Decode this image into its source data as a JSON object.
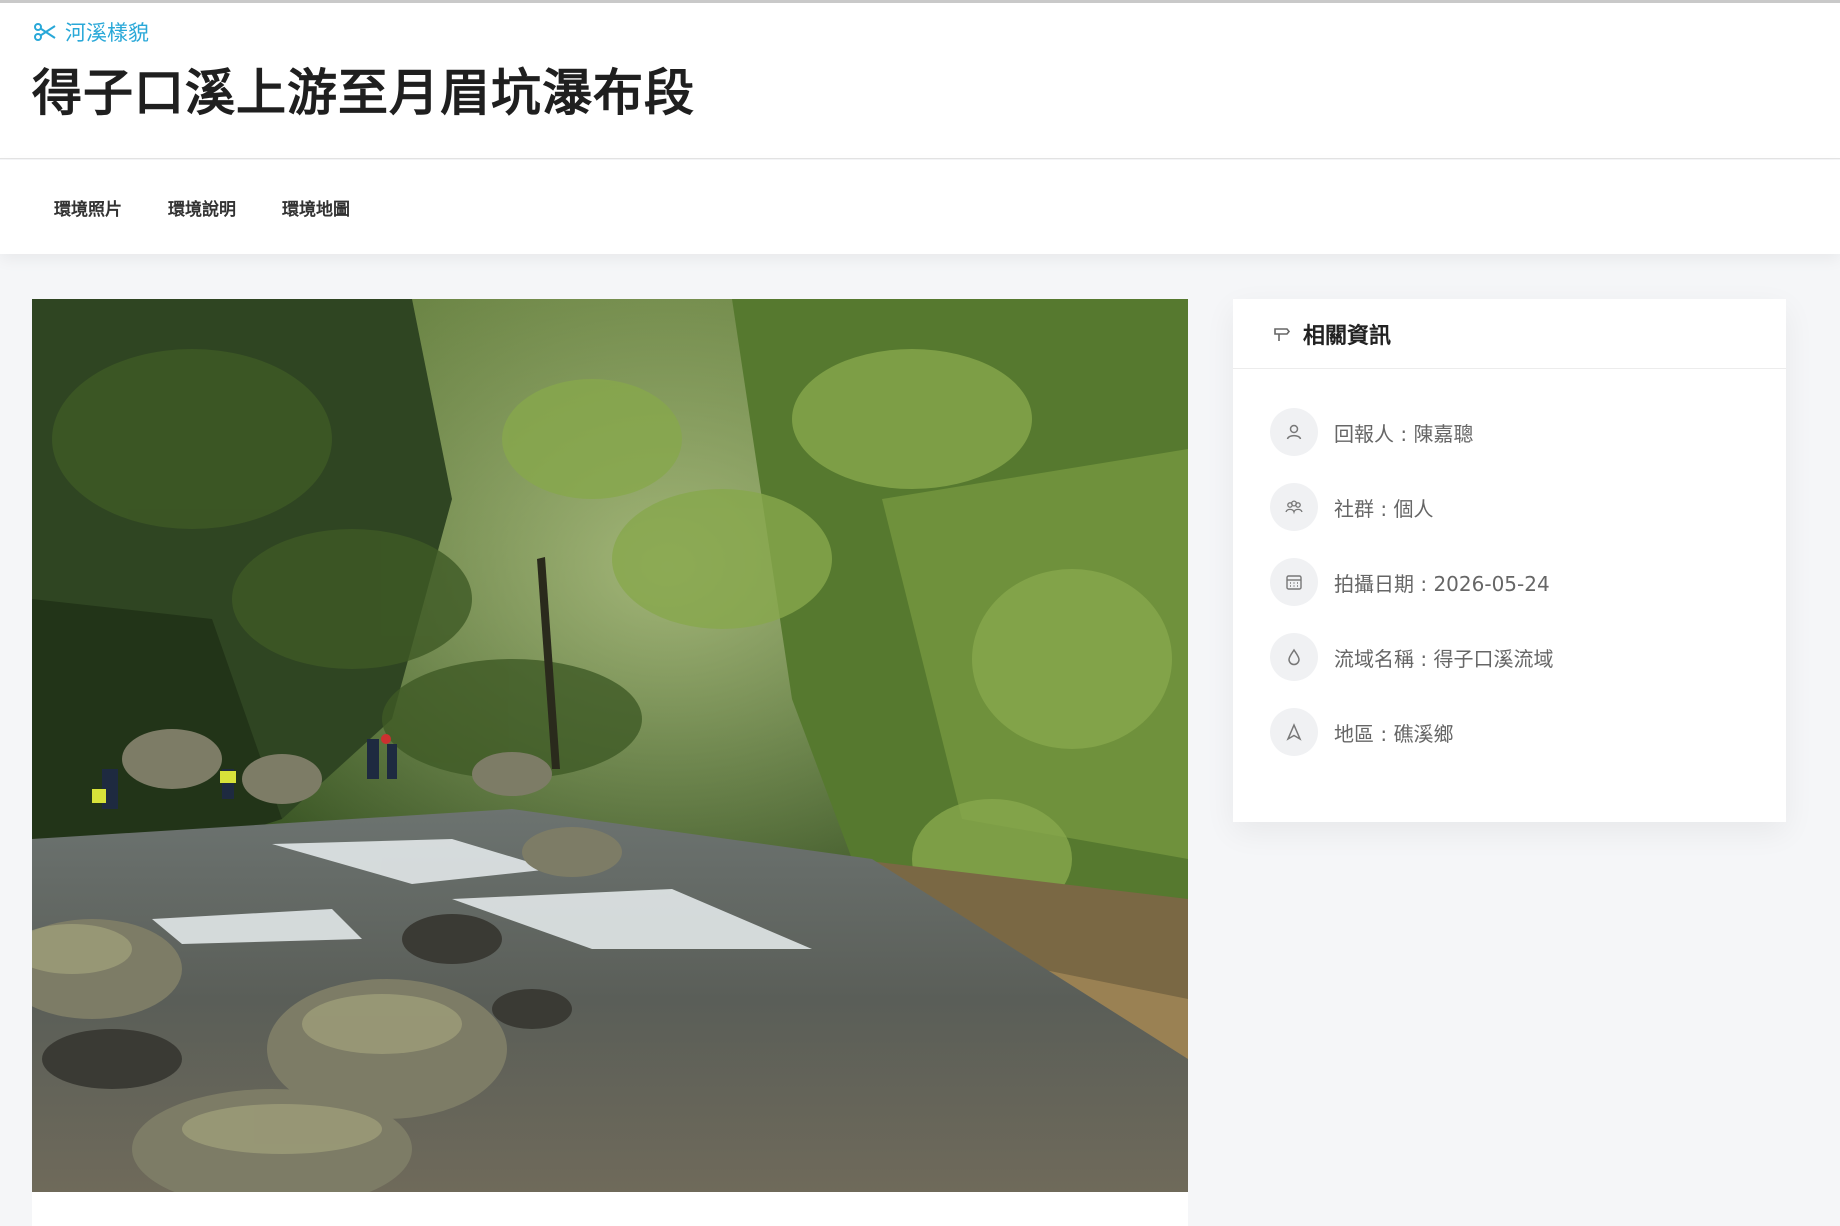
{
  "header": {
    "category": "河溪樣貌",
    "title": "得子口溪上游至月眉坑瀑布段"
  },
  "tabs": [
    {
      "label": "環境照片"
    },
    {
      "label": "環境說明"
    },
    {
      "label": "環境地圖"
    }
  ],
  "photo": {
    "icon": "river-photo"
  },
  "info": {
    "title": "相關資訊",
    "items": [
      {
        "icon": "user-icon",
        "label": "回報人 : 陳嘉聰"
      },
      {
        "icon": "group-icon",
        "label": "社群 : 個人"
      },
      {
        "icon": "calendar-icon",
        "label": "拍攝日期 : 2026-05-24"
      },
      {
        "icon": "water-drop-icon",
        "label": "流域名稱 : 得子口溪流域"
      },
      {
        "icon": "location-icon",
        "label": "地區 : 礁溪鄉"
      }
    ]
  },
  "colors": {
    "accent": "#29a8d8",
    "page_bg": "#f5f6f8"
  }
}
